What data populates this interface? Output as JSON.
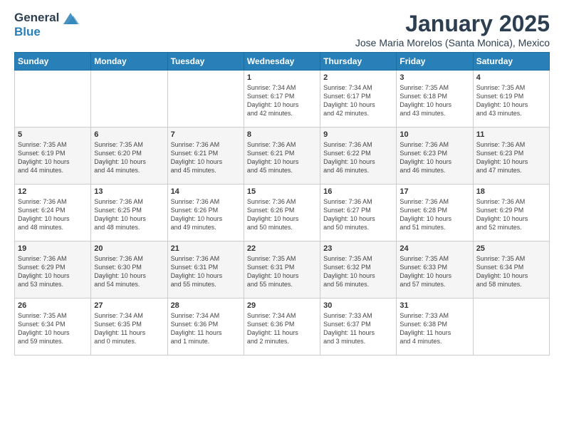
{
  "header": {
    "logo_line1": "General",
    "logo_line2": "Blue",
    "title": "January 2025",
    "subtitle": "Jose Maria Morelos (Santa Monica), Mexico"
  },
  "days_of_week": [
    "Sunday",
    "Monday",
    "Tuesday",
    "Wednesday",
    "Thursday",
    "Friday",
    "Saturday"
  ],
  "weeks": [
    [
      {
        "day": "",
        "info": ""
      },
      {
        "day": "",
        "info": ""
      },
      {
        "day": "",
        "info": ""
      },
      {
        "day": "1",
        "info": "Sunrise: 7:34 AM\nSunset: 6:17 PM\nDaylight: 10 hours\nand 42 minutes."
      },
      {
        "day": "2",
        "info": "Sunrise: 7:34 AM\nSunset: 6:17 PM\nDaylight: 10 hours\nand 42 minutes."
      },
      {
        "day": "3",
        "info": "Sunrise: 7:35 AM\nSunset: 6:18 PM\nDaylight: 10 hours\nand 43 minutes."
      },
      {
        "day": "4",
        "info": "Sunrise: 7:35 AM\nSunset: 6:19 PM\nDaylight: 10 hours\nand 43 minutes."
      }
    ],
    [
      {
        "day": "5",
        "info": "Sunrise: 7:35 AM\nSunset: 6:19 PM\nDaylight: 10 hours\nand 44 minutes."
      },
      {
        "day": "6",
        "info": "Sunrise: 7:35 AM\nSunset: 6:20 PM\nDaylight: 10 hours\nand 44 minutes."
      },
      {
        "day": "7",
        "info": "Sunrise: 7:36 AM\nSunset: 6:21 PM\nDaylight: 10 hours\nand 45 minutes."
      },
      {
        "day": "8",
        "info": "Sunrise: 7:36 AM\nSunset: 6:21 PM\nDaylight: 10 hours\nand 45 minutes."
      },
      {
        "day": "9",
        "info": "Sunrise: 7:36 AM\nSunset: 6:22 PM\nDaylight: 10 hours\nand 46 minutes."
      },
      {
        "day": "10",
        "info": "Sunrise: 7:36 AM\nSunset: 6:23 PM\nDaylight: 10 hours\nand 46 minutes."
      },
      {
        "day": "11",
        "info": "Sunrise: 7:36 AM\nSunset: 6:23 PM\nDaylight: 10 hours\nand 47 minutes."
      }
    ],
    [
      {
        "day": "12",
        "info": "Sunrise: 7:36 AM\nSunset: 6:24 PM\nDaylight: 10 hours\nand 48 minutes."
      },
      {
        "day": "13",
        "info": "Sunrise: 7:36 AM\nSunset: 6:25 PM\nDaylight: 10 hours\nand 48 minutes."
      },
      {
        "day": "14",
        "info": "Sunrise: 7:36 AM\nSunset: 6:26 PM\nDaylight: 10 hours\nand 49 minutes."
      },
      {
        "day": "15",
        "info": "Sunrise: 7:36 AM\nSunset: 6:26 PM\nDaylight: 10 hours\nand 50 minutes."
      },
      {
        "day": "16",
        "info": "Sunrise: 7:36 AM\nSunset: 6:27 PM\nDaylight: 10 hours\nand 50 minutes."
      },
      {
        "day": "17",
        "info": "Sunrise: 7:36 AM\nSunset: 6:28 PM\nDaylight: 10 hours\nand 51 minutes."
      },
      {
        "day": "18",
        "info": "Sunrise: 7:36 AM\nSunset: 6:29 PM\nDaylight: 10 hours\nand 52 minutes."
      }
    ],
    [
      {
        "day": "19",
        "info": "Sunrise: 7:36 AM\nSunset: 6:29 PM\nDaylight: 10 hours\nand 53 minutes."
      },
      {
        "day": "20",
        "info": "Sunrise: 7:36 AM\nSunset: 6:30 PM\nDaylight: 10 hours\nand 54 minutes."
      },
      {
        "day": "21",
        "info": "Sunrise: 7:36 AM\nSunset: 6:31 PM\nDaylight: 10 hours\nand 55 minutes."
      },
      {
        "day": "22",
        "info": "Sunrise: 7:35 AM\nSunset: 6:31 PM\nDaylight: 10 hours\nand 55 minutes."
      },
      {
        "day": "23",
        "info": "Sunrise: 7:35 AM\nSunset: 6:32 PM\nDaylight: 10 hours\nand 56 minutes."
      },
      {
        "day": "24",
        "info": "Sunrise: 7:35 AM\nSunset: 6:33 PM\nDaylight: 10 hours\nand 57 minutes."
      },
      {
        "day": "25",
        "info": "Sunrise: 7:35 AM\nSunset: 6:34 PM\nDaylight: 10 hours\nand 58 minutes."
      }
    ],
    [
      {
        "day": "26",
        "info": "Sunrise: 7:35 AM\nSunset: 6:34 PM\nDaylight: 10 hours\nand 59 minutes."
      },
      {
        "day": "27",
        "info": "Sunrise: 7:34 AM\nSunset: 6:35 PM\nDaylight: 11 hours\nand 0 minutes."
      },
      {
        "day": "28",
        "info": "Sunrise: 7:34 AM\nSunset: 6:36 PM\nDaylight: 11 hours\nand 1 minute."
      },
      {
        "day": "29",
        "info": "Sunrise: 7:34 AM\nSunset: 6:36 PM\nDaylight: 11 hours\nand 2 minutes."
      },
      {
        "day": "30",
        "info": "Sunrise: 7:33 AM\nSunset: 6:37 PM\nDaylight: 11 hours\nand 3 minutes."
      },
      {
        "day": "31",
        "info": "Sunrise: 7:33 AM\nSunset: 6:38 PM\nDaylight: 11 hours\nand 4 minutes."
      },
      {
        "day": "",
        "info": ""
      }
    ]
  ]
}
